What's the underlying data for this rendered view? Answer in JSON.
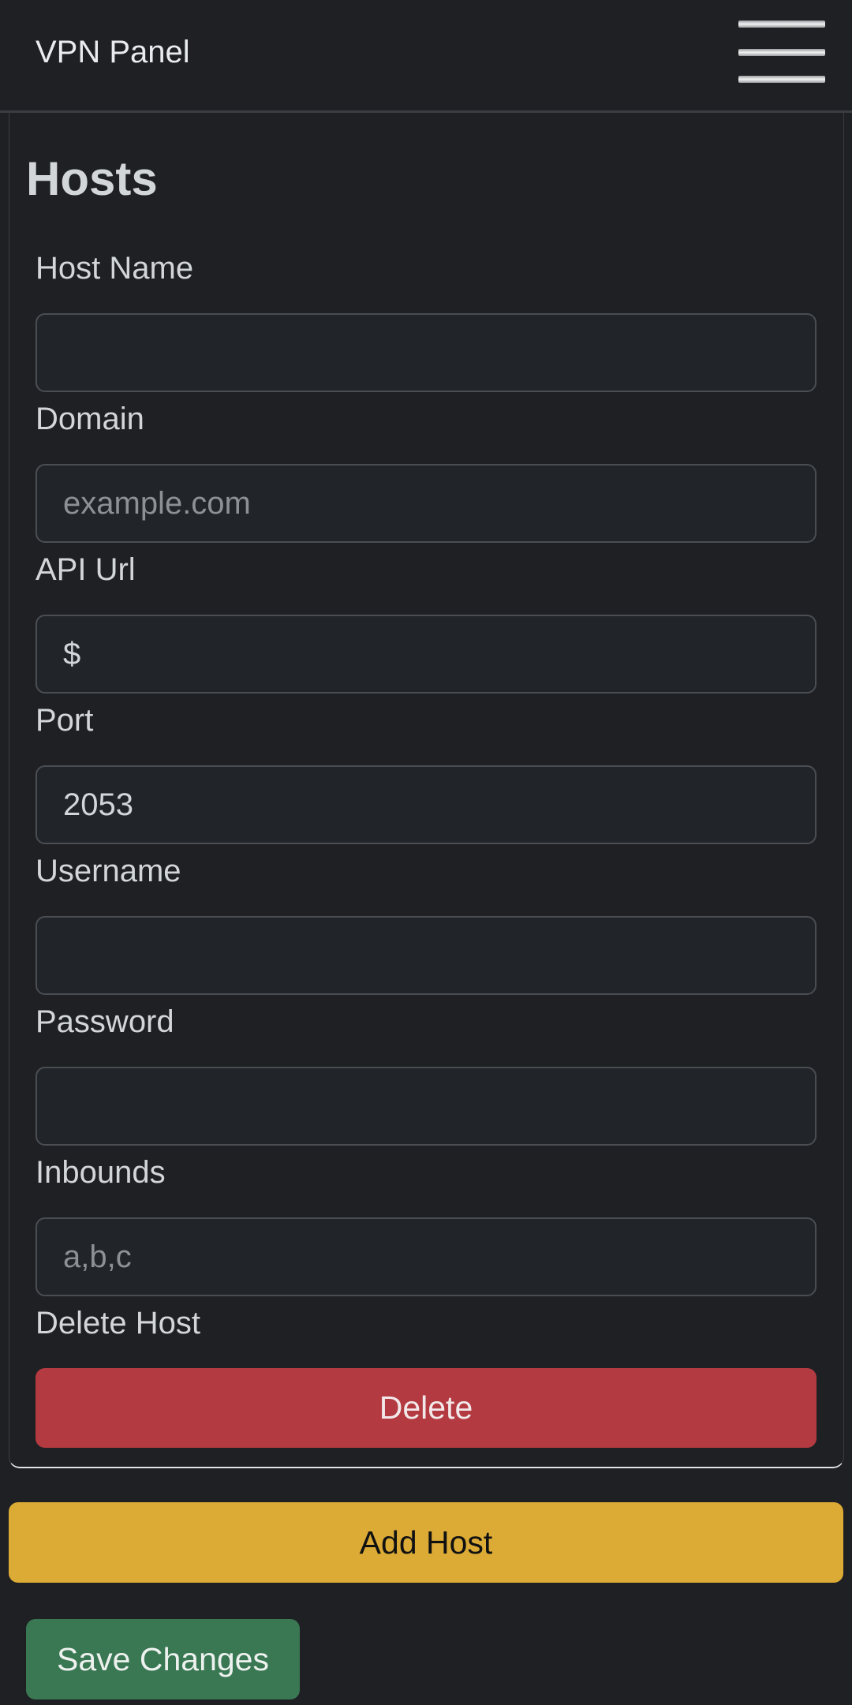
{
  "header": {
    "brand": "VPN Panel",
    "menu_icon": "hamburger-menu-icon"
  },
  "page": {
    "title": "Hosts"
  },
  "form": {
    "host_name": {
      "label": "Host Name",
      "value": "",
      "placeholder": ""
    },
    "domain": {
      "label": "Domain",
      "value": "",
      "placeholder": "example.com"
    },
    "api_url": {
      "label": "API Url",
      "value": "$",
      "placeholder": ""
    },
    "port": {
      "label": "Port",
      "value": "2053",
      "placeholder": ""
    },
    "username": {
      "label": "Username",
      "value": "",
      "placeholder": ""
    },
    "password": {
      "label": "Password",
      "value": "",
      "placeholder": ""
    },
    "inbounds": {
      "label": "Inbounds",
      "value": "",
      "placeholder": "a,b,c"
    },
    "delete_host_label": "Delete Host",
    "delete_button": "Delete"
  },
  "actions": {
    "add_host": "Add Host",
    "save_changes": "Save Changes"
  },
  "colors": {
    "background": "#1e2023",
    "danger": "#b33a41",
    "warning": "#dbab36",
    "success": "#3a7753"
  }
}
